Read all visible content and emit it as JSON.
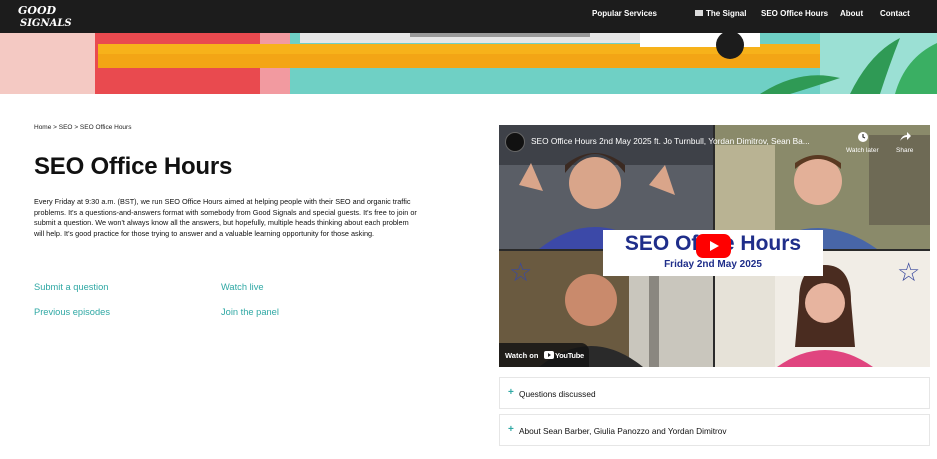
{
  "header": {
    "logo_text_1": "GOOD",
    "logo_text_2": "SIGNALS",
    "nav": [
      {
        "label": "Popular Services"
      },
      {
        "label": "The Signal"
      },
      {
        "label": "SEO Office Hours"
      },
      {
        "label": "About"
      },
      {
        "label": "Contact"
      }
    ]
  },
  "breadcrumb": {
    "home": "Home",
    "sep1": ">",
    "seo": "SEO",
    "sep2": ">",
    "current": "SEO Office Hours"
  },
  "page": {
    "title": "SEO Office Hours",
    "intro": "Every Friday at 9:30 a.m. (BST), we run SEO Office Hours aimed at helping people with their SEO and organic traffic problems. It's a questions-and-answers format with somebody from Good Signals and special guests. It's free to join or submit a question. We won't always know all the answers, but hopefully, multiple heads thinking about each problem will help. It's good practice for those trying to answer and a valuable learning opportunity for those asking."
  },
  "links": {
    "submit": "Submit a question",
    "watch_live": "Watch live",
    "previous": "Previous episodes",
    "join": "Join the panel"
  },
  "video": {
    "title": "SEO Office Hours 2nd May 2025 ft. Jo Turnbull, Yordan Dimitrov, Sean Ba...",
    "watch_later": "Watch later",
    "share": "Share",
    "banner_title": "SEO Office Hours",
    "banner_sub": "Friday 2nd May 2025",
    "watch_on": "Watch on",
    "youtube": "YouTube"
  },
  "accordions": [
    {
      "label": "Questions discussed"
    },
    {
      "label": "About Sean Barber, Giulia Panozzo and Yordan Dimitrov"
    }
  ],
  "colors": {
    "nav_bg": "#1c1c1c",
    "accent": "#2fa8a4",
    "banner_text": "#1f2e8a",
    "play": "#ff0000"
  }
}
